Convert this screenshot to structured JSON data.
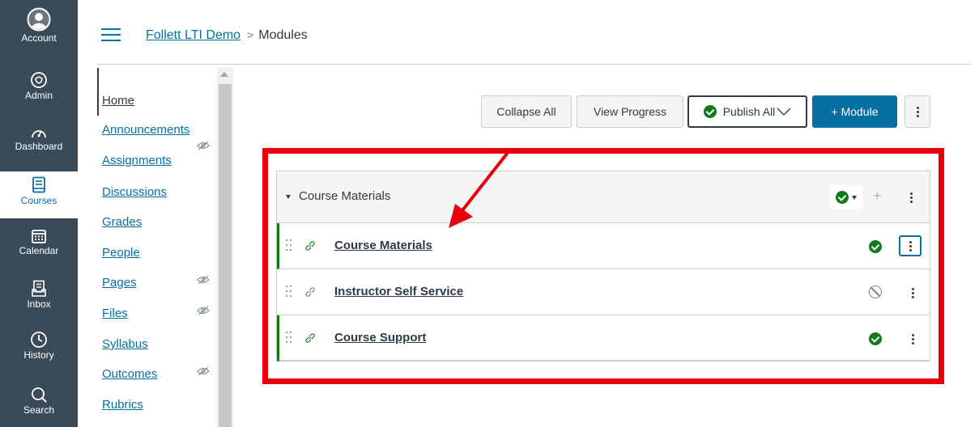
{
  "global_nav": [
    {
      "label": "Account",
      "icon": "account-avatar-icon"
    },
    {
      "label": "Admin",
      "icon": "shield-icon"
    },
    {
      "label": "Dashboard",
      "icon": "speedometer-icon"
    },
    {
      "label": "Courses",
      "icon": "book-icon",
      "active": true
    },
    {
      "label": "Calendar",
      "icon": "calendar-icon"
    },
    {
      "label": "Inbox",
      "icon": "inbox-icon"
    },
    {
      "label": "History",
      "icon": "clock-icon"
    },
    {
      "label": "Search",
      "icon": "search-icon"
    }
  ],
  "breadcrumb": {
    "course": "Follett LTI Demo",
    "separator": ">",
    "current": "Modules"
  },
  "course_nav": [
    {
      "label": "Home",
      "active": true
    },
    {
      "label": "Announcements"
    },
    {
      "label": "Assignments",
      "hidden_icon": true
    },
    {
      "label": "Discussions"
    },
    {
      "label": "Grades"
    },
    {
      "label": "People"
    },
    {
      "label": "Pages",
      "hidden_icon": true
    },
    {
      "label": "Files",
      "hidden_icon": true
    },
    {
      "label": "Syllabus"
    },
    {
      "label": "Outcomes",
      "hidden_icon": true
    },
    {
      "label": "Rubrics"
    }
  ],
  "toolbar": {
    "collapse_all": "Collapse All",
    "view_progress": "View Progress",
    "publish_all": "Publish All",
    "add_module": "+ Module"
  },
  "module": {
    "title": "Course Materials",
    "published": true,
    "items": [
      {
        "title": "Course Materials",
        "type": "external-link",
        "published": true
      },
      {
        "title": "Instructor Self Service",
        "type": "external-link",
        "published": false
      },
      {
        "title": "Course Support",
        "type": "external-link",
        "published": true
      }
    ]
  },
  "colors": {
    "nav_bg": "#394b58",
    "link": "#0770a3",
    "published": "#127a1b",
    "highlight": "#e8000b"
  }
}
